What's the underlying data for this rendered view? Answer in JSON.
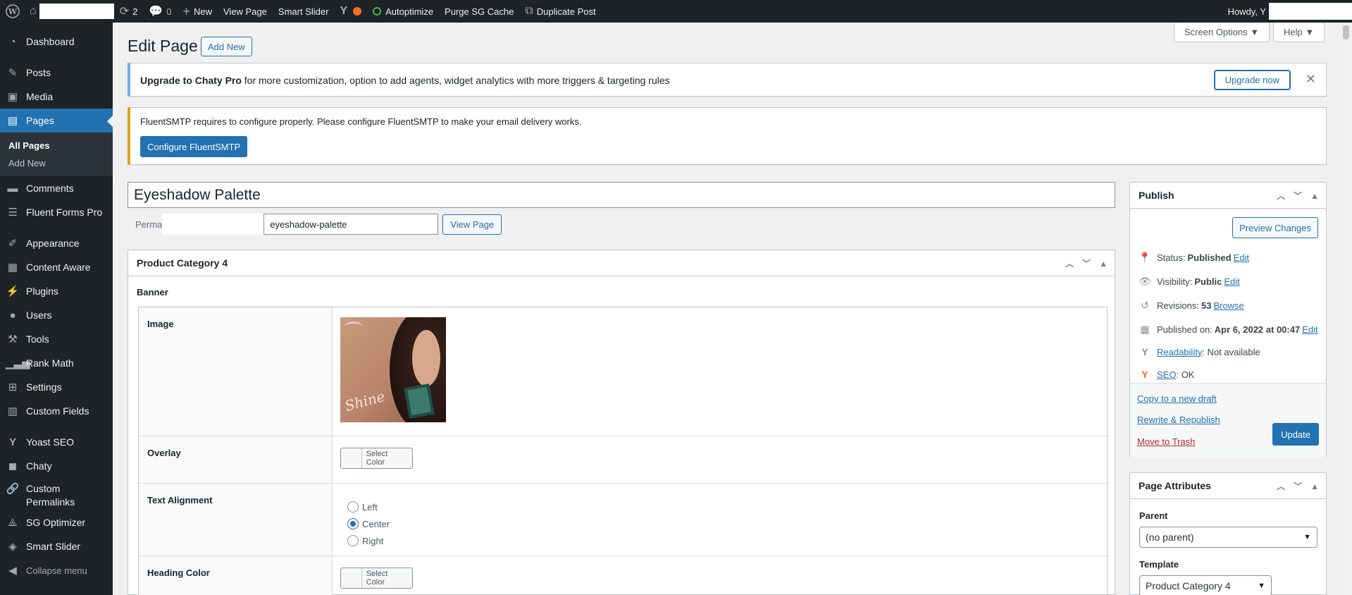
{
  "adminbar": {
    "comments_pending": "2",
    "comment_count": "0",
    "new_label": "New",
    "view_page": "View Page",
    "smart_slider": "Smart Slider",
    "autoptimize": "Autoptimize",
    "purge": "Purge SG Cache",
    "duplicate": "Duplicate Post",
    "howdy": "Howdy, Y"
  },
  "sidebar": {
    "dashboard": "Dashboard",
    "posts": "Posts",
    "media": "Media",
    "pages": "Pages",
    "all_pages": "All Pages",
    "add_new": "Add New",
    "comments": "Comments",
    "fluent_forms": "Fluent Forms Pro",
    "appearance": "Appearance",
    "content_aware": "Content Aware",
    "plugins": "Plugins",
    "users": "Users",
    "tools": "Tools",
    "rank_math": "Rank Math",
    "settings": "Settings",
    "custom_fields": "Custom Fields",
    "yoast": "Yoast SEO",
    "chaty": "Chaty",
    "custom_permalinks": "Custom Permalinks",
    "sg_optimizer": "SG Optimizer",
    "smart_slider": "Smart Slider",
    "collapse": "Collapse menu"
  },
  "top_buttons": {
    "screen_options": "Screen Options ▼",
    "help": "Help ▼"
  },
  "header": {
    "title": "Edit Page",
    "add_new": "Add New"
  },
  "notices": {
    "chaty_strong": "Upgrade to Chaty Pro",
    "chaty_text": " for more customization, option to add agents, widget analytics with more triggers & targeting rules",
    "chaty_button": "Upgrade now",
    "smtp_text": "FluentSMTP requires to configure properly. Please configure FluentSMTP to make your email delivery works.",
    "smtp_button": "Configure FluentSMTP"
  },
  "editor": {
    "title_value": "Eyeshadow Palette",
    "permalink_label": "Perma",
    "slug": "eyeshadow-palette",
    "view_page": "View Page"
  },
  "acf": {
    "box_title": "Product Category 4",
    "group_label": "Banner",
    "fields": {
      "image_label": "Image",
      "banner_image_text": "Shine",
      "overlay_label": "Overlay",
      "select_color": "Select Color",
      "alignment_label": "Text Alignment",
      "alignment_options": [
        "Left",
        "Center",
        "Right"
      ],
      "alignment_selected": "Center",
      "heading_color_label": "Heading Color"
    }
  },
  "publish": {
    "title": "Publish",
    "preview": "Preview Changes",
    "status_label": "Status:",
    "status_value": "Published",
    "visibility_label": "Visibility:",
    "visibility_value": "Public",
    "revisions_label": "Revisions:",
    "revisions_value": "53",
    "browse": "Browse",
    "published_label": "Published on:",
    "published_value": "Apr 6, 2022 at 00:47",
    "edit": "Edit",
    "readability_link": "Readability",
    "readability_value": ": Not available",
    "seo_link": "SEO",
    "seo_value": ": OK",
    "copy_draft": "Copy to a new draft",
    "rewrite": "Rewrite & Republish",
    "trash": "Move to Trash",
    "update": "Update"
  },
  "attributes": {
    "title": "Page Attributes",
    "parent_label": "Parent",
    "parent_value": "(no parent)",
    "template_label": "Template",
    "template_value": "Product Category 4"
  },
  "colors": {
    "adminbar": "#1d2327",
    "accent": "#2271b1",
    "notice_info": "#72aee6",
    "notice_warning": "#dba617"
  }
}
